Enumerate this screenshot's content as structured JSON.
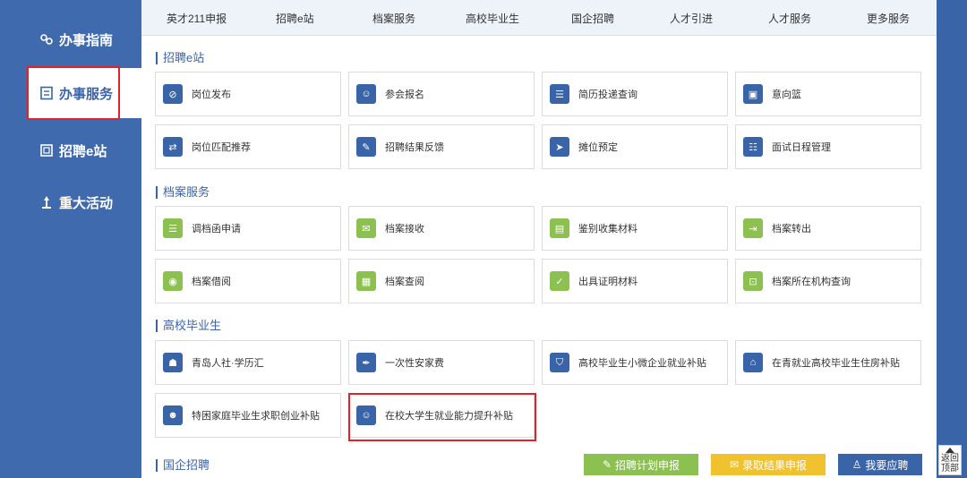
{
  "sidebar": {
    "items": [
      {
        "label": "办事指南",
        "icon": "link-icon"
      },
      {
        "label": "办事服务",
        "icon": "document-icon"
      },
      {
        "label": "招聘e站",
        "icon": "clipboard-icon"
      },
      {
        "label": "重大活动",
        "icon": "torch-icon"
      }
    ]
  },
  "topnav": [
    "英才211申报",
    "招聘e站",
    "档案服务",
    "高校毕业生",
    "国企招聘",
    "人才引进",
    "人才服务",
    "更多服务"
  ],
  "sections": [
    {
      "title": "招聘e站",
      "items": [
        "岗位发布",
        "参会报名",
        "简历投递查询",
        "意向篮",
        "岗位匹配推荐",
        "招聘结果反馈",
        "摊位预定",
        "面试日程管理"
      ]
    },
    {
      "title": "档案服务",
      "items": [
        "调档函申请",
        "档案接收",
        "鉴别收集材料",
        "档案转出",
        "档案借阅",
        "档案查阅",
        "出具证明材料",
        "档案所在机构查询"
      ]
    },
    {
      "title": "高校毕业生",
      "items": [
        "青岛人社·学历汇",
        "一次性安家费",
        "高校毕业生小微企业就业补贴",
        "在青就业高校毕业生住房补贴",
        "特困家庭毕业生求职创业补贴",
        "在校大学生就业能力提升补贴"
      ]
    },
    {
      "title": "国企招聘",
      "items": []
    }
  ],
  "buttons": {
    "plan": "招聘计划申报",
    "result": "录取结果申报",
    "apply": "我要应聘"
  },
  "totop": {
    "line1": "返回",
    "line2": "顶部"
  },
  "colors": {
    "brand": "#3a64a8",
    "green": "#8cc152",
    "yellow": "#f0c230",
    "highlight": "#e3212a"
  }
}
